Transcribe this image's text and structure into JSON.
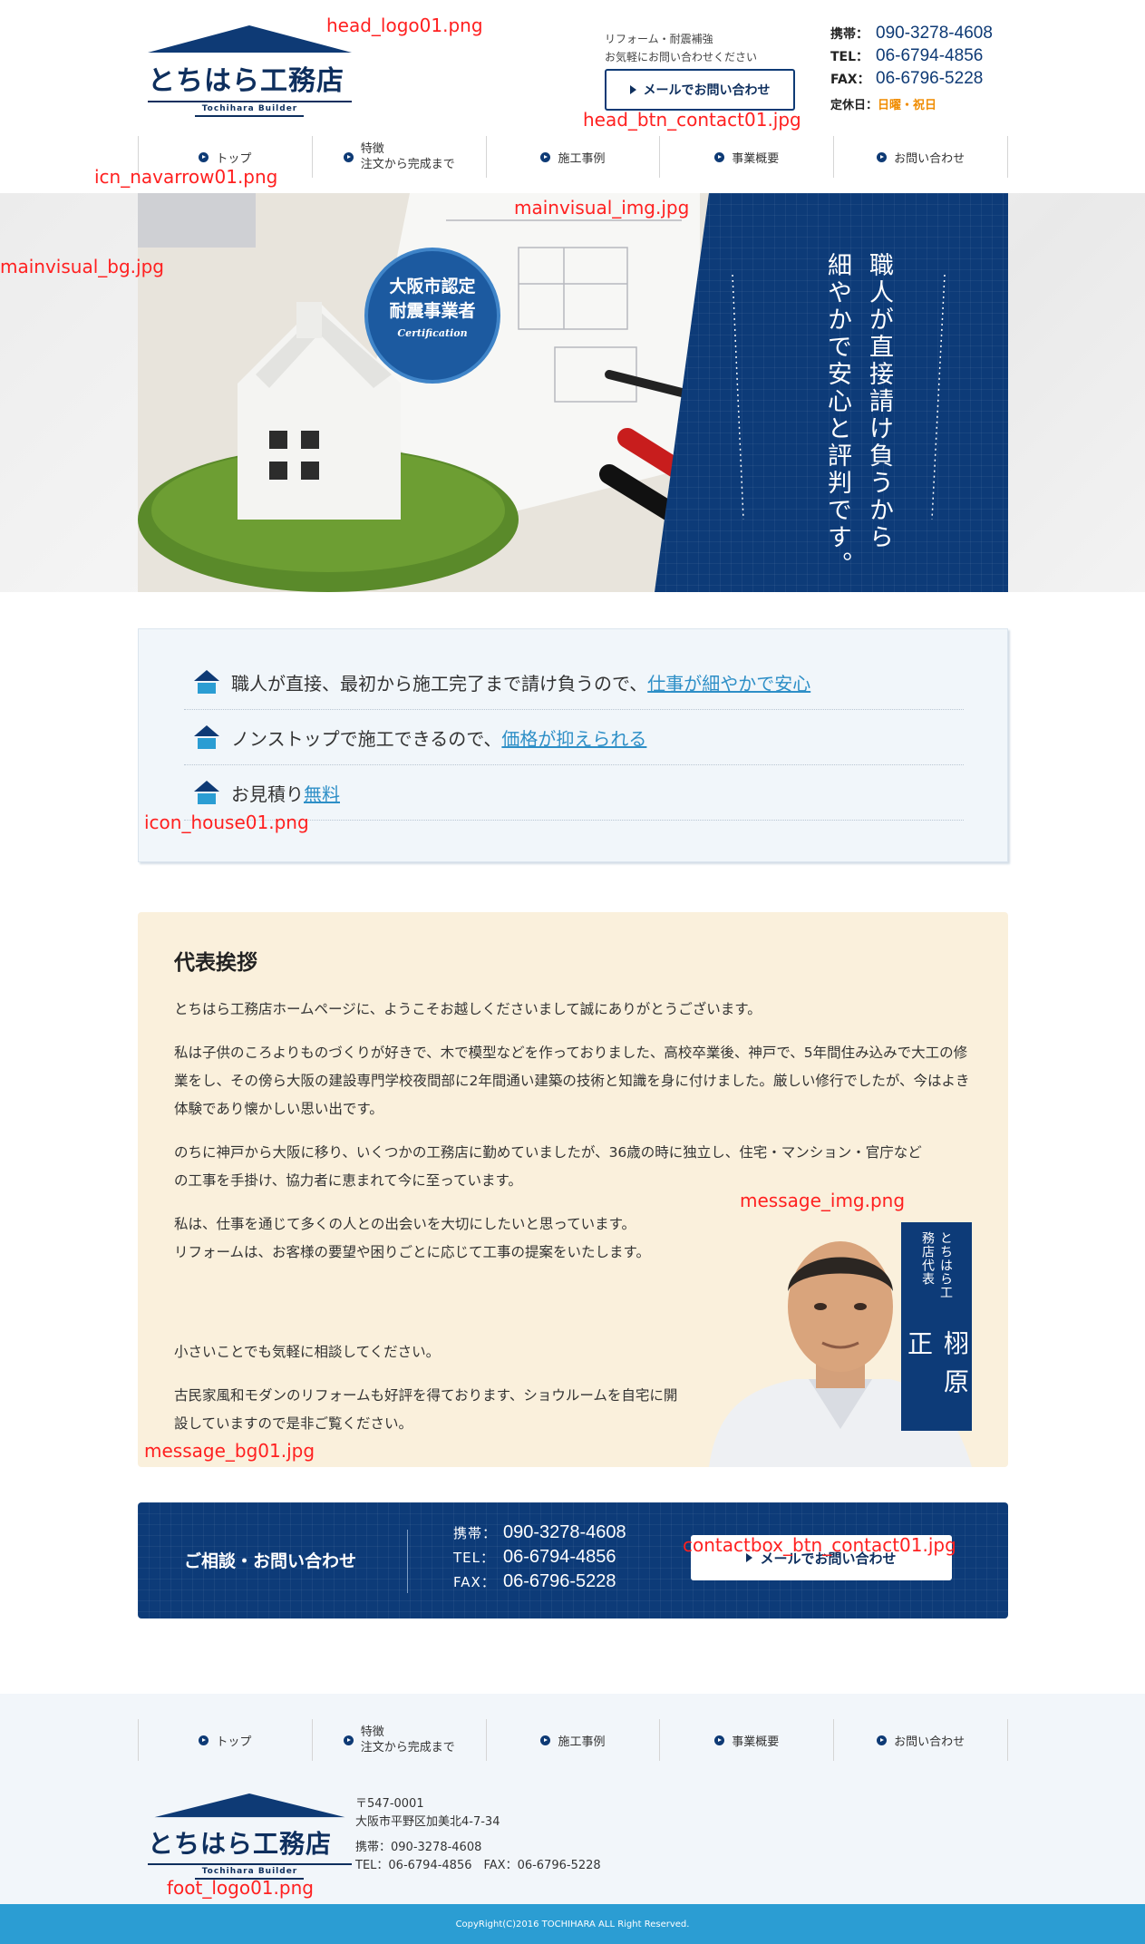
{
  "header": {
    "logo_text": "とちはら工務店",
    "logo_sub": "Tochihara Builder",
    "note_line1": "リフォーム・耐震補強",
    "note_line2": "お気軽にお問い合わせください",
    "mail_button": "メールでお問い合わせ",
    "tel": [
      {
        "label": "携帯：",
        "value": "090-3278-4608"
      },
      {
        "label": "TEL：",
        "value": "06-6794-4856"
      },
      {
        "label": "FAX：",
        "value": "06-6796-5228"
      }
    ],
    "holiday_label": "定休日：",
    "holiday_value": "日曜・祝日"
  },
  "nav": [
    {
      "label": "トップ"
    },
    {
      "line1": "特徴",
      "line2": "注文から完成まで"
    },
    {
      "label": "施工事例"
    },
    {
      "label": "事業概要"
    },
    {
      "label": "お問い合わせ"
    }
  ],
  "mainvisual": {
    "copy_line1": "職人が直接請け負うから",
    "copy_line2": "細やかで安心と評判です。",
    "badge_line1": "大阪市認定",
    "badge_line2": "耐震事業者",
    "badge_sub": "Certification"
  },
  "features": [
    {
      "text": "職人が直接、最初から施工完了まで請け負うので、",
      "link": "仕事が細やかで安心"
    },
    {
      "text": "ノンストップで施工できるので、",
      "link": "価格が抑えられる"
    },
    {
      "text": "お見積り",
      "link": "無料"
    }
  ],
  "message": {
    "title": "代表挨拶",
    "p1": "とちはら工務店ホームページに、ようこそお越しくださいまして誠にありがとうございます。",
    "p2": "私は子供のころよりものづくりが好きで、木で模型などを作っておりました、高校卒業後、神戸で、5年間住み込みで大工の修業をし、その傍ら大阪の建設専門学校夜間部に2年間通い建築の技術と知識を身に付けました。厳しい修行でしたが、今はよき体験であり懐かしい思い出です。",
    "p3": "のちに神戸から大阪に移り、いくつかの工務店に勤めていましたが、36歳の時に独立し、住宅・マンション・官庁などの工事を手掛け、協力者に恵まれて今に至っています。",
    "p4a": "私は、仕事を通じて多くの人との出会いを大切にしたいと思っています。",
    "p4b": "リフォームは、お客様の要望や困りごとに応じて工事の提案をいたします。",
    "p5": "小さいことでも気軽に相談してください。",
    "p6": "古民家風和モダンのリフォームも好評を得ております、ショウルームを自宅に開設していますので是非ご覧ください。",
    "rep_title": "とちはら工務店代表",
    "rep_name": "栩原　正"
  },
  "contact": {
    "title": "ご相談・お問い合わせ",
    "tel": [
      {
        "label": "携帯：",
        "value": "090-3278-4608"
      },
      {
        "label": "TEL：",
        "value": "06-6794-4856"
      },
      {
        "label": "FAX：",
        "value": "06-6796-5228"
      }
    ],
    "mail_button": "メールでお問い合わせ"
  },
  "footer": {
    "postal": "〒547-0001",
    "address": "大阪市平野区加美北4-7-34",
    "mobile": "携帯：090-3278-4608",
    "telfax": "TEL：06-6794-4856　FAX：06-6796-5228",
    "copyright": "CopyRight(C)2016 TOCHIHARA ALL Right Reserved."
  },
  "annotations": {
    "head_logo": "head_logo01.png",
    "head_btn": "head_btn_contact01.jpg",
    "nav_arrow": "icn_navarrow01.png",
    "mv_img": "mainvisual_img.jpg",
    "mv_bg": "mainvisual_bg.jpg",
    "house_icon": "icon_house01.png",
    "message_img": "message_img.png",
    "message_bg": "message_bg01.jpg",
    "contact_btn": "contactbox_btn_contact01.jpg",
    "foot_logo": "foot_logo01.png"
  },
  "colors": {
    "navy": "#0d3b78",
    "accent_blue": "#2e8fc7",
    "holiday_orange": "#f08c00",
    "annotation_red": "#ff2020",
    "copyright_bar": "#2b9dd3"
  }
}
